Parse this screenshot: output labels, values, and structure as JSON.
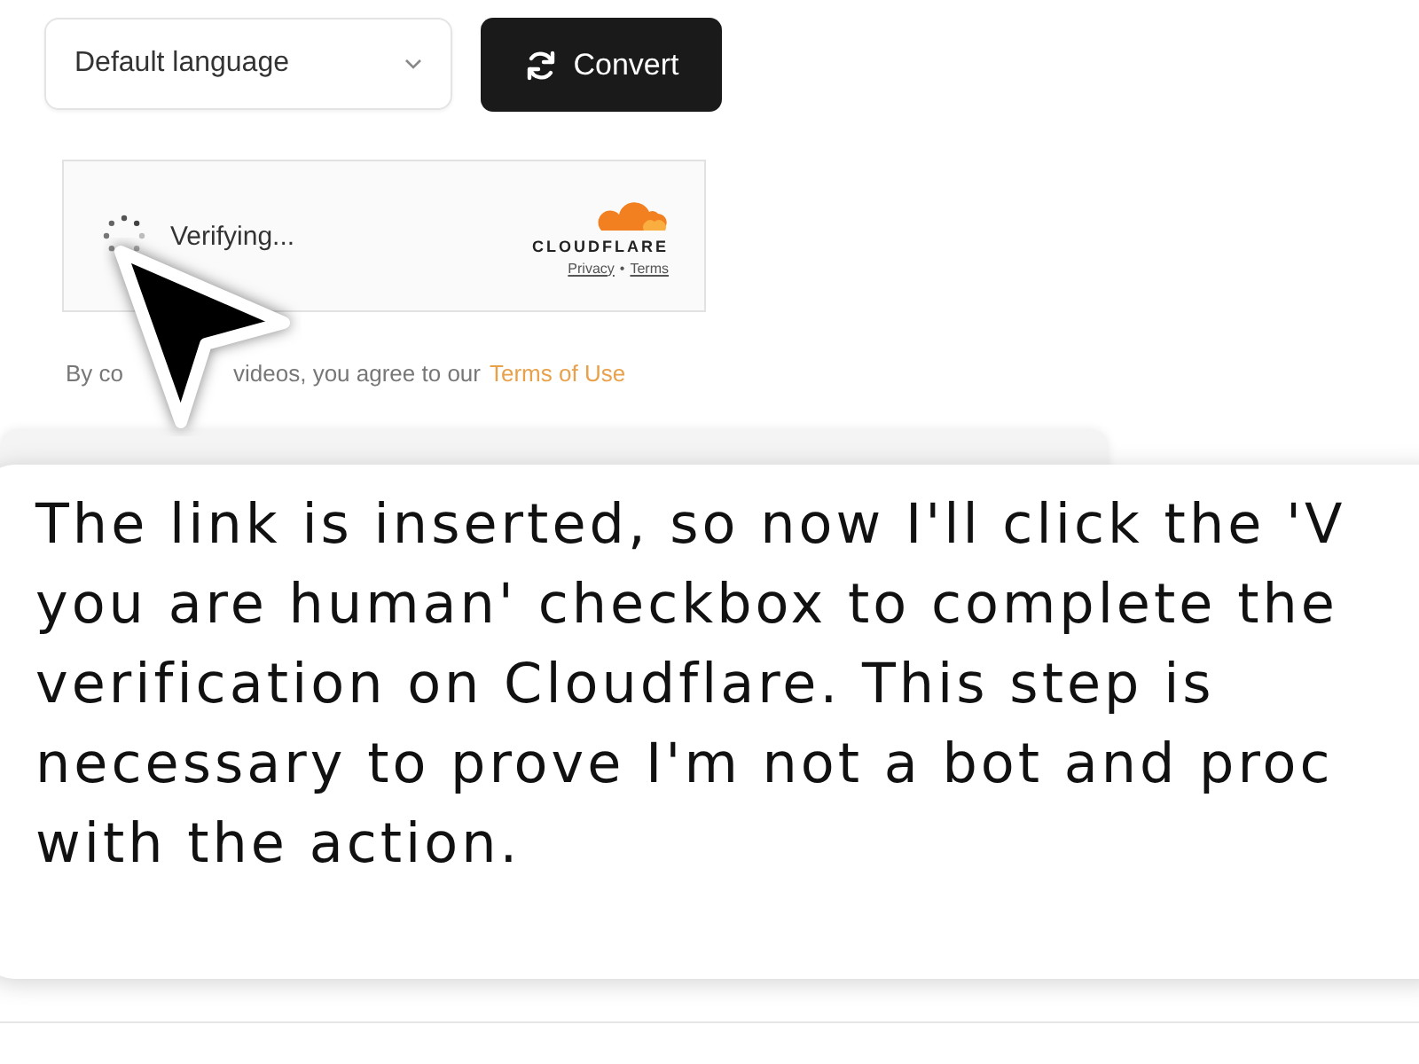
{
  "language_select": {
    "value": "Default language"
  },
  "convert_button": {
    "label": "Convert"
  },
  "verification_widget": {
    "status": "Verifying...",
    "brand": "CLOUDFLARE",
    "links": [
      "Privacy",
      "Terms"
    ],
    "separator": "•"
  },
  "terms_notice": {
    "parts": [
      "By co",
      "videos, you agree to our"
    ],
    "link": "Terms of Use"
  },
  "caption": {
    "text": "The link is inserted, so now I'll click the 'V\nyou are human' checkbox to complete the\nverification on Cloudflare. This step is\nnecessary to prove I'm not a bot and proc\nwith the action."
  }
}
